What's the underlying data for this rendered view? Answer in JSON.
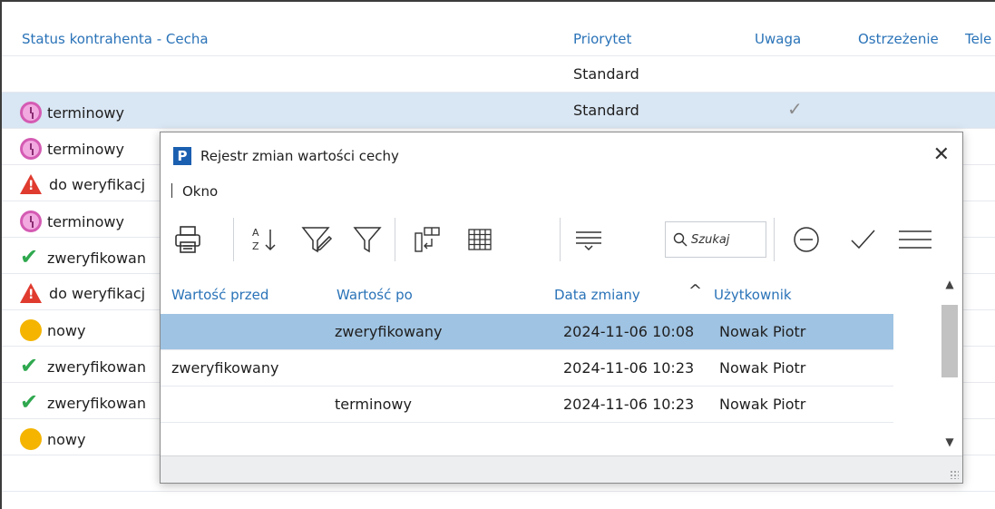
{
  "background": {
    "headers": [
      "Status kontrahenta - Cecha",
      "Priorytet",
      "Uwaga",
      "Ostrzeżenie",
      "Tele"
    ],
    "rows": [
      {
        "icon": "",
        "status": "",
        "priority": "Standard",
        "check": ""
      },
      {
        "icon": "alarm-clock-icon",
        "status": "terminowy",
        "priority": "Standard",
        "check": "✓",
        "selected": true
      },
      {
        "icon": "alarm-clock-icon",
        "status": "terminowy",
        "priority": "",
        "check": ""
      },
      {
        "icon": "warning-icon",
        "status": "do weryfikacj",
        "priority": "",
        "check": ""
      },
      {
        "icon": "alarm-clock-icon",
        "status": "terminowy",
        "priority": "",
        "check": ""
      },
      {
        "icon": "checkmark-icon",
        "status": "zweryfikowan",
        "priority": "",
        "check": ""
      },
      {
        "icon": "warning-icon",
        "status": "do weryfikacj",
        "priority": "",
        "check": ""
      },
      {
        "icon": "yellow-dot-icon",
        "status": "nowy",
        "priority": "",
        "check": ""
      },
      {
        "icon": "checkmark-icon",
        "status": "zweryfikowan",
        "priority": "",
        "check": ""
      },
      {
        "icon": "checkmark-icon",
        "status": "zweryfikowan",
        "priority": "",
        "check": ""
      },
      {
        "icon": "yellow-dot-icon",
        "status": "nowy",
        "priority": "",
        "check": ""
      }
    ]
  },
  "dialog": {
    "logo": "P",
    "title": "Rejestr zmian wartości cechy",
    "close": "✕",
    "menu": [
      "Okno"
    ],
    "toolbar": {
      "icons": [
        "printer-icon",
        "sort-az-icon",
        "filter-edit-icon",
        "filter-icon",
        "columns-icon",
        "grid-icon",
        "group-icon",
        "clear-icon",
        "accept-icon",
        "menu-icon"
      ],
      "search_placeholder": "Szukaj"
    },
    "grid": {
      "headers": [
        "Wartość przed",
        "Wartość po",
        "Data zmiany",
        "Użytkownik"
      ],
      "sort_indicator": "^",
      "rows": [
        {
          "before": "",
          "after": "zweryfikowany",
          "date": "2024-11-06 10:08",
          "user": "Nowak Piotr",
          "selected": true
        },
        {
          "before": "zweryfikowany",
          "after": "",
          "date": "2024-11-06 10:23",
          "user": "Nowak Piotr"
        },
        {
          "before": "",
          "after": "terminowy",
          "date": "2024-11-06 10:23",
          "user": "Nowak Piotr"
        }
      ]
    }
  }
}
